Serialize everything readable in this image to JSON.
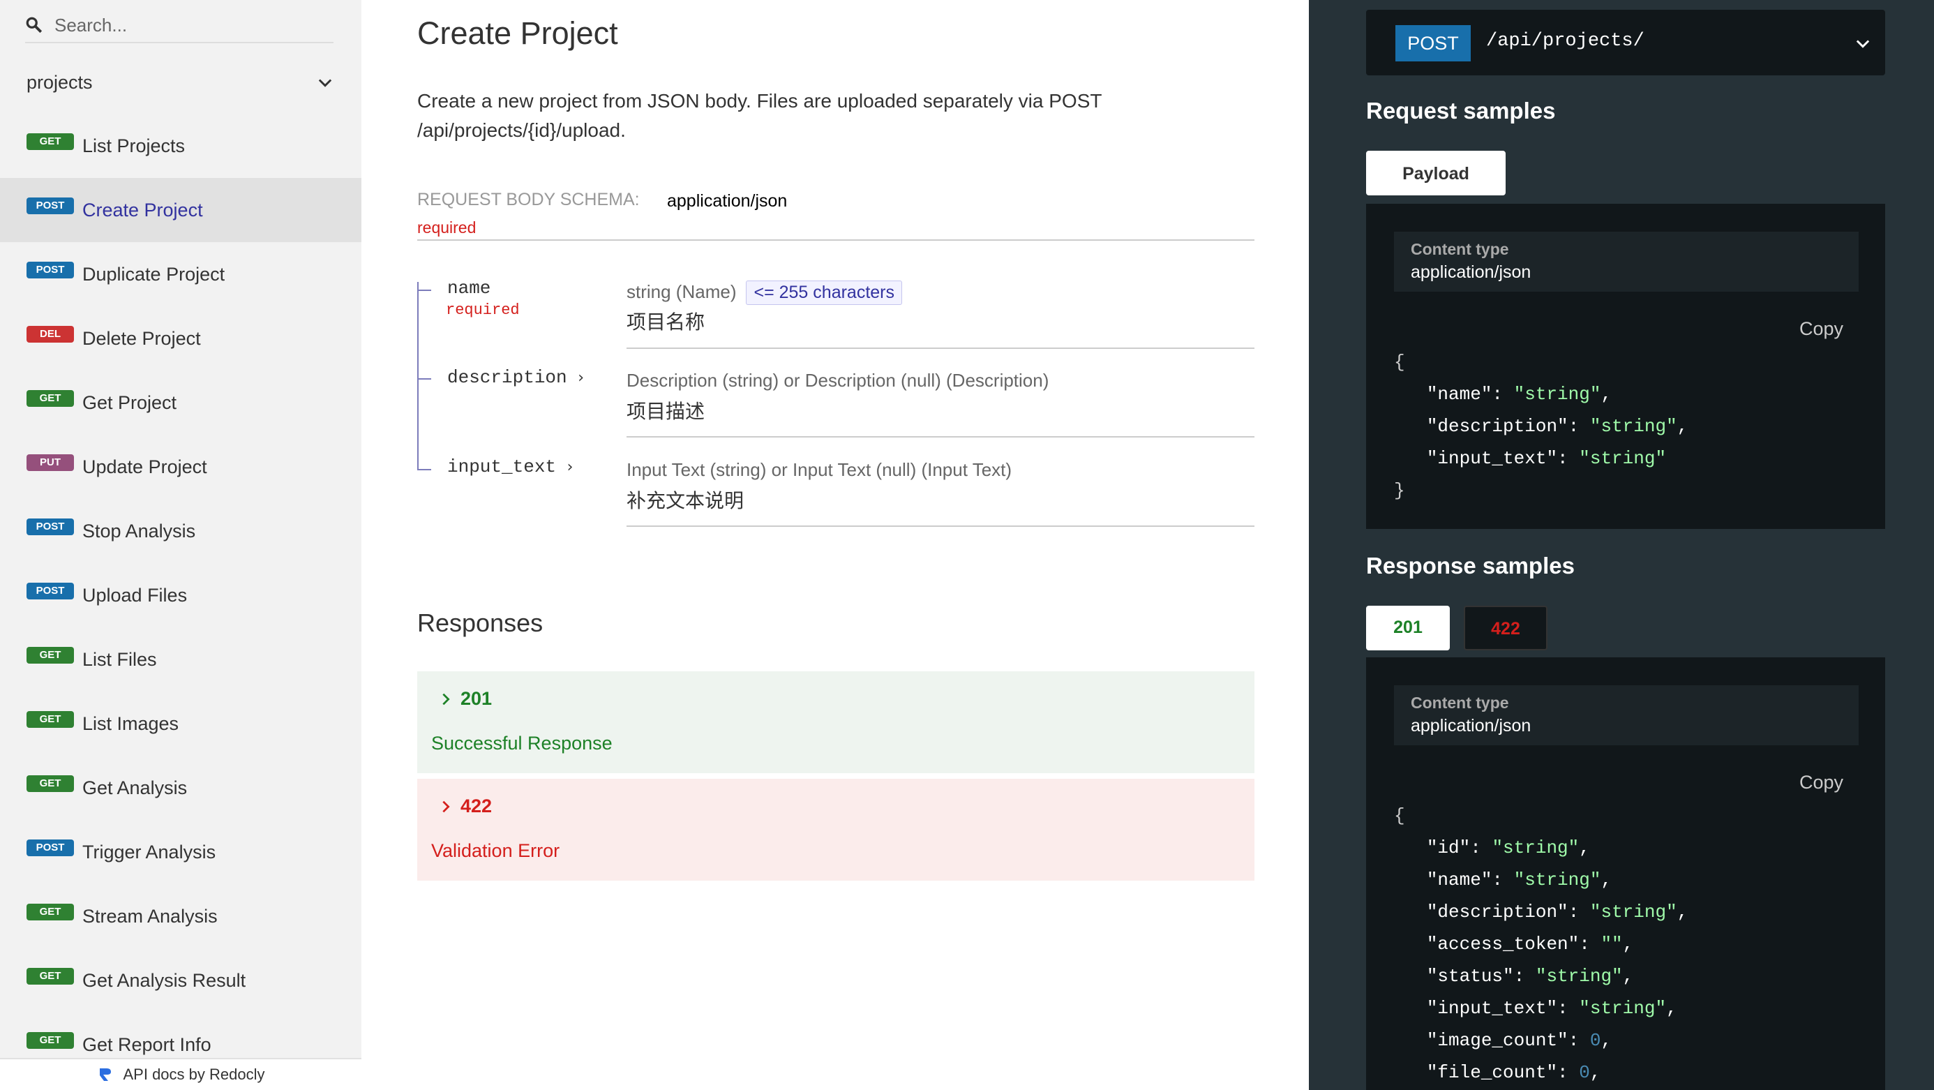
{
  "sidebar": {
    "search_placeholder": "Search...",
    "group_label": "projects",
    "items": [
      {
        "method": "GET",
        "label": "List Projects"
      },
      {
        "method": "POST",
        "label": "Create Project"
      },
      {
        "method": "POST",
        "label": "Duplicate Project"
      },
      {
        "method": "DEL",
        "label": "Delete Project"
      },
      {
        "method": "GET",
        "label": "Get Project"
      },
      {
        "method": "PUT",
        "label": "Update Project"
      },
      {
        "method": "POST",
        "label": "Stop Analysis"
      },
      {
        "method": "POST",
        "label": "Upload Files"
      },
      {
        "method": "GET",
        "label": "List Files"
      },
      {
        "method": "GET",
        "label": "List Images"
      },
      {
        "method": "GET",
        "label": "Get Analysis"
      },
      {
        "method": "POST",
        "label": "Trigger Analysis"
      },
      {
        "method": "GET",
        "label": "Stream Analysis"
      },
      {
        "method": "GET",
        "label": "Get Analysis Result"
      },
      {
        "method": "GET",
        "label": "Get Report Info"
      }
    ],
    "active_index": 1,
    "footer": "API docs by Redocly"
  },
  "main": {
    "title": "Create Project",
    "description": "Create a new project from JSON body. Files are uploaded separately via POST /api/projects/{id}/upload.",
    "schema_label": "Request Body schema:",
    "schema_type": "application/json",
    "required": "required",
    "props": [
      {
        "name": "name",
        "required": "required",
        "type": "string (Name)",
        "constraint": "<= 255 characters",
        "desc": "项目名称"
      },
      {
        "name": "description",
        "type": "Description (string) or Description (null) (Description)",
        "desc": "项目描述"
      },
      {
        "name": "input_text",
        "type": "Input Text (string) or Input Text (null) (Input Text)",
        "desc": "补充文本说明"
      }
    ],
    "responses_title": "Responses",
    "responses": [
      {
        "code": "201",
        "message": "Successful Response"
      },
      {
        "code": "422",
        "message": "Validation Error"
      }
    ]
  },
  "right": {
    "method": "POST",
    "path": "/api/projects/",
    "request_title": "Request samples",
    "payload_tab": "Payload",
    "content_type_label": "Content type",
    "content_type_value": "application/json",
    "copy_label": "Copy",
    "request_code": [
      "{",
      "\"name\": \"string\",",
      "\"description\": \"string\",",
      "\"input_text\": \"string\"",
      "}"
    ],
    "response_title": "Response samples",
    "tab_201": "201",
    "tab_422": "422",
    "response_code": [
      "{",
      "\"id\": \"string\",",
      "\"name\": \"string\",",
      "\"description\": \"string\",",
      "\"access_token\": \"\",",
      "\"status\": \"string\",",
      "\"input_text\": \"string\",",
      "\"image_count\": 0,",
      "\"file_count\": 0,"
    ]
  },
  "colors": {
    "get": "#2f8132",
    "post": "#186fab",
    "delete": "#cc3333",
    "put": "#95507c",
    "right_panel": "#263238",
    "success": "#1d8127",
    "error": "#d41f1c"
  }
}
